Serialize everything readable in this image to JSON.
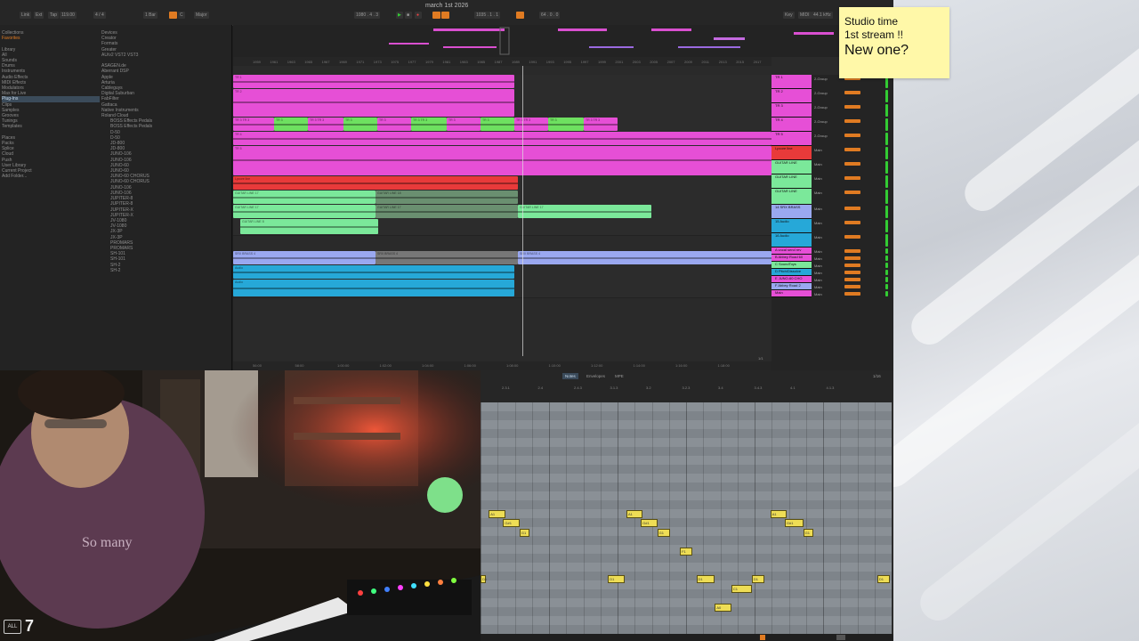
{
  "project_title": "march 1st 2026",
  "sticky_note": {
    "line1": "Studio time",
    "line2": "1st stream !!",
    "line3": "New one?"
  },
  "transport": {
    "link": "Link",
    "ext": "Ext",
    "tap": "Tap",
    "tempo": "119.00",
    "signature": "4 / 4",
    "bar": "1 Bar",
    "key": "C",
    "scale": "Major",
    "position": "1080 . 4 . 3",
    "loop_start": "1035 . 1 . 1",
    "loop_len": "64 . 0 . 0",
    "cpu_label": "Key",
    "midi_label": "MIDI",
    "sample_rate": "44.1 kHz"
  },
  "browser": {
    "collections_label": "Collections",
    "favorites": "Favorites",
    "library_label": "Library",
    "library": [
      "All",
      "Sounds",
      "Drums",
      "Instruments",
      "Audio Effects",
      "MIDI Effects",
      "Modulators",
      "Max for Live",
      "Plug-Ins",
      "Clips",
      "Samples",
      "Grooves",
      "Tunings",
      "Templates"
    ],
    "places_label": "Places",
    "places": [
      "Packs",
      "Splice",
      "Cloud",
      "Push",
      "User Library",
      "Current Project",
      "Add Folder..."
    ],
    "filters": [
      "Devices",
      "Creator",
      "Formats",
      "Greater"
    ],
    "plugin_formats": "AU/v2  VST2  VST3",
    "plugins": [
      "ASAGEN.de",
      "Aberrant DSP",
      "Apple",
      "Arturia",
      "Cableguys",
      "Digital Suburban",
      "FabFilter",
      "Gattaca",
      "Native Instruments",
      "Roland Cloud"
    ],
    "roland": [
      "BOSS Effects Pedals",
      "BOSS Effects Pedals",
      "D-50",
      "D-50",
      "JD-800",
      "JD-800",
      "JUNO-106",
      "JUNO-106",
      "JUNO-60",
      "JUNO-60",
      "JUNO-60 CHORUS",
      "JUNO-60 CHORUS",
      "JUNO-106",
      "JUNO-106",
      "JUPITER-8",
      "JUPITER-8",
      "JUPITER-X",
      "JUPITER-X",
      "JV-1080",
      "JV-1080",
      "JX-3P",
      "JX-3P",
      "PROMARS",
      "PROMARS",
      "SH-101",
      "SH-101",
      "SH-2",
      "SH-2"
    ]
  },
  "arrangement": {
    "ruler": [
      "1959",
      "1961",
      "1963",
      "1965",
      "1967",
      "1969",
      "1971",
      "1973",
      "1975",
      "1977",
      "1979",
      "1981",
      "1983",
      "1985",
      "1987",
      "1989",
      "1991",
      "1993",
      "1995",
      "1997",
      "1999",
      "2001",
      "2003",
      "2005",
      "2007",
      "2009",
      "2011",
      "2013",
      "2015",
      "2017"
    ],
    "time_marks": [
      "56:00",
      "58:00",
      "1:00:00",
      "1:02:00",
      "1:04:00",
      "1:06:00",
      "1:08:00",
      "1:10:00",
      "1:12:00",
      "1:14:00",
      "1:16:00",
      "1:18:00"
    ],
    "tracks": [
      {
        "name": "TR 1",
        "clips": [
          "TR 1",
          "TR 1",
          "TR 1",
          "TR 1",
          "TR 1",
          "TR 1",
          "TR 1",
          "TR 1"
        ]
      },
      {
        "name": "TR 2",
        "clips": [
          "TR 2",
          "TR 2"
        ]
      },
      {
        "name": "TR 3",
        "clips": [
          "TR 3 TR 3",
          "TR 3",
          "TR 3 TR 3",
          "TR 3",
          "TR 3",
          "TR 3 TR 3",
          "TR 3",
          "TR 3",
          "TR 3 TR 3",
          "TR 3",
          "TR 3 TR 3"
        ]
      },
      {
        "name": "TR 4",
        "clips": [
          "TR 4",
          "TR 4"
        ]
      },
      {
        "name": "TR 5",
        "clips": [
          "TR 5",
          "TR 5"
        ]
      },
      {
        "name": "Lpcore Line",
        "clips": [
          "Lpcore line"
        ]
      },
      {
        "name": "GUITAR LINE",
        "clips": [
          "GUITAR LINE 17",
          "GUITAR LINE 18",
          "GUITAR LINE 19"
        ]
      },
      {
        "name": "GUITAR LINE",
        "clips": [
          "GUITAR LINE 17",
          "GUITAR LINE 17"
        ]
      },
      {
        "name": "GUITAR LINE",
        "clips": [
          "GUITAR LINE 8",
          "GUITAR LINE 8"
        ]
      },
      {
        "name": "14 SRX BRASS",
        "clips": [
          "SRX BRASS 4",
          "SRX BRASS 4",
          "SRX BRASS 4",
          "SRX BRASS 4",
          "SRX BRASS 2"
        ]
      },
      {
        "name": "15 Audio",
        "clips": [
          "Audio",
          "Audio",
          "Audio",
          "Audio"
        ]
      },
      {
        "name": "16 Audio",
        "clips": [
          "Audio"
        ]
      }
    ],
    "mixer_heads": [
      "TR 1",
      "TR 2",
      "TR 3",
      "TR 4",
      "TR 5",
      "Lpcore line",
      "GUITAR LINE",
      "GUITAR LINE",
      "GUITAR LINE",
      "14 SRX BRASS",
      "15 Audio",
      "16 Audio",
      "A vocal send rev",
      "B Abbey Road 60",
      "C SoundToys",
      "D Pitch/Dissolve",
      "E JUNO-60 CHO",
      "F Abbey Road 2",
      "Main"
    ],
    "routing_group": "2-Group",
    "routing_main": "Main",
    "page_indicator": "1/1"
  },
  "clip_view": {
    "tabs": [
      "Notes",
      "Envelopes",
      "MPE"
    ],
    "zoom": "1/16",
    "ruler": [
      "2.3.1",
      "2.4",
      "2.4.3",
      "3.1.3",
      "3.2",
      "3.2.3",
      "3.4",
      "3.4.3",
      "4.1",
      "4.1.3"
    ],
    "notes": [
      {
        "label": "A1",
        "pitch": 9,
        "start": 0.02,
        "len": 0.04
      },
      {
        "label": "G#1",
        "pitch": 8,
        "start": 0.055,
        "len": 0.04
      },
      {
        "label": "G1",
        "pitch": 7,
        "start": 0.095,
        "len": 0.025
      },
      {
        "label": "D1",
        "pitch": 2,
        "start": -0.002,
        "len": 0.012
      },
      {
        "label": "D1",
        "pitch": 2,
        "start": 0.31,
        "len": 0.04
      },
      {
        "label": "A1",
        "pitch": 9,
        "start": 0.355,
        "len": 0.04
      },
      {
        "label": "G#1",
        "pitch": 8,
        "start": 0.39,
        "len": 0.04
      },
      {
        "label": "G1",
        "pitch": 7,
        "start": 0.43,
        "len": 0.03
      },
      {
        "label": "F1",
        "pitch": 5,
        "start": 0.485,
        "len": 0.03
      },
      {
        "label": "D1",
        "pitch": 2,
        "start": 0.525,
        "len": 0.045
      },
      {
        "label": "C1",
        "pitch": 1,
        "start": 0.61,
        "len": 0.05
      },
      {
        "label": "A0",
        "pitch": -1,
        "start": 0.57,
        "len": 0.04
      },
      {
        "label": "D1",
        "pitch": 2,
        "start": 0.66,
        "len": 0.03
      },
      {
        "label": "A1",
        "pitch": 9,
        "start": 0.705,
        "len": 0.04
      },
      {
        "label": "G#1",
        "pitch": 8,
        "start": 0.74,
        "len": 0.045
      },
      {
        "label": "G1",
        "pitch": 7,
        "start": 0.785,
        "len": 0.025
      },
      {
        "label": "D1",
        "pitch": 2,
        "start": 0.965,
        "len": 0.03
      }
    ]
  },
  "webcam": {
    "badge": "ALL",
    "channel_number": "7"
  }
}
